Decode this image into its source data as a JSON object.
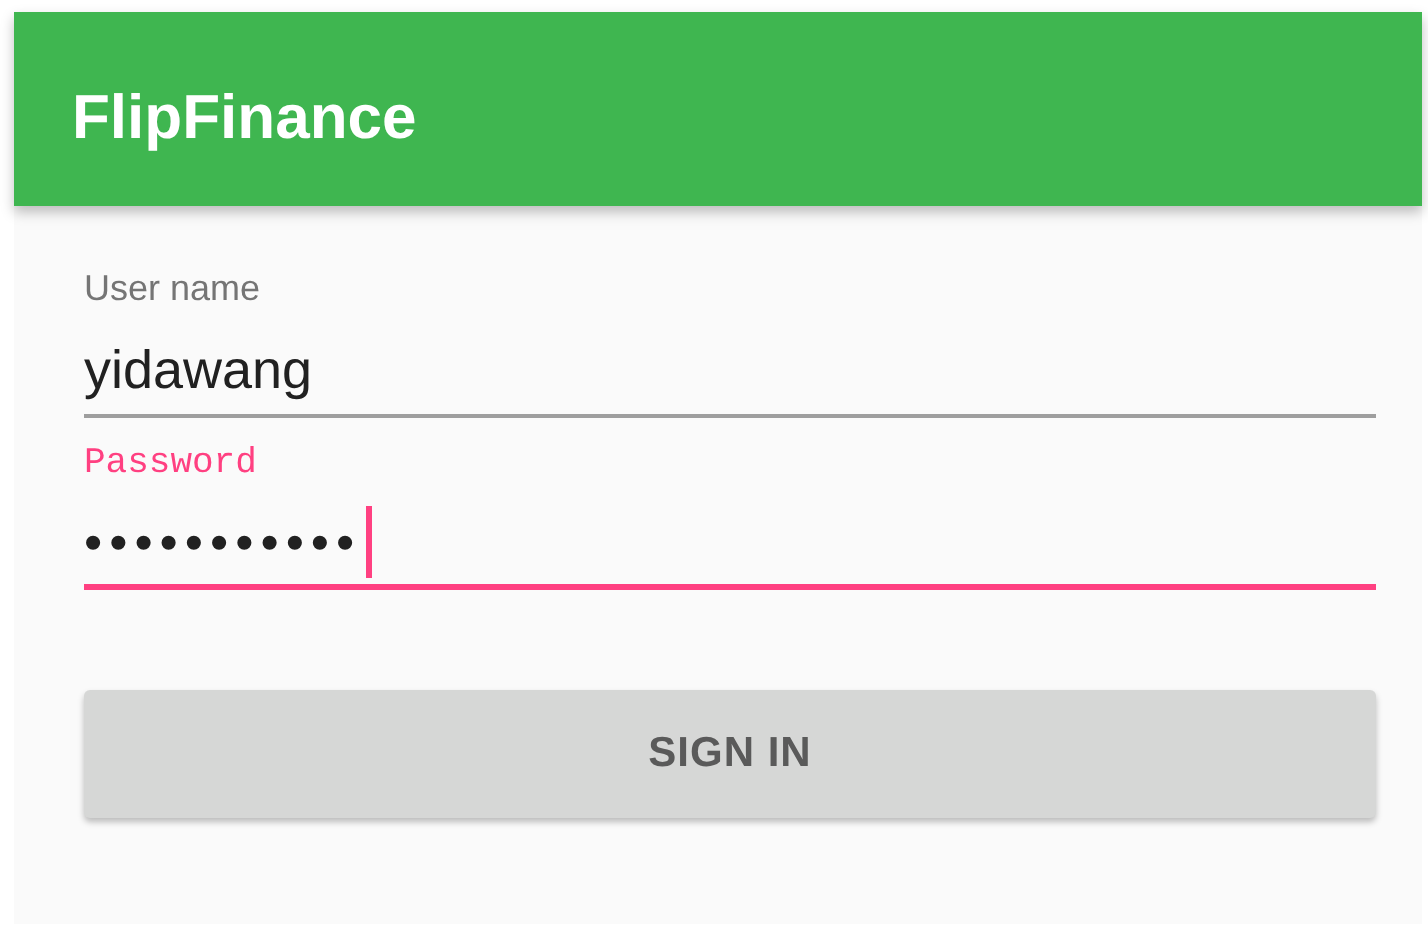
{
  "app_bar": {
    "title": "FlipFinance"
  },
  "fields": [
    {
      "label": "User name",
      "value": "yidawang",
      "focused": false,
      "kind": "text"
    },
    {
      "label": "Password",
      "value": "•••••••••••",
      "focused": true,
      "kind": "password"
    }
  ],
  "button": {
    "label": "SIGN IN"
  }
}
